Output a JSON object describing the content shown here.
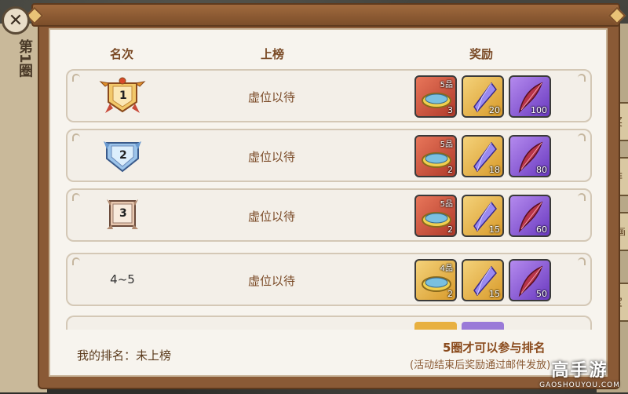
{
  "background": {
    "left_title": "第1圈",
    "right_tabs": [
      "奖",
      "排",
      "动画",
      "宝"
    ]
  },
  "header": {
    "rank_col": "名次",
    "list_col": "上榜",
    "reward_col": "奖励"
  },
  "rows": [
    {
      "rank": "1",
      "rank_type": "gold-badge",
      "status": "虚位以待",
      "rewards": [
        {
          "icon": "ring-icon",
          "color": "red",
          "grade": "5品",
          "count": "3"
        },
        {
          "icon": "crystal-icon",
          "color": "gold",
          "count": "20"
        },
        {
          "icon": "feather-icon",
          "color": "purple",
          "count": "100"
        }
      ]
    },
    {
      "rank": "2",
      "rank_type": "silver-badge",
      "status": "虚位以待",
      "rewards": [
        {
          "icon": "ring-icon",
          "color": "red",
          "grade": "5品",
          "count": "2"
        },
        {
          "icon": "crystal-icon",
          "color": "gold",
          "count": "18"
        },
        {
          "icon": "feather-icon",
          "color": "purple",
          "count": "80"
        }
      ]
    },
    {
      "rank": "3",
      "rank_type": "bronze-badge",
      "status": "虚位以待",
      "rewards": [
        {
          "icon": "ring-icon",
          "color": "red",
          "grade": "5品",
          "count": "2"
        },
        {
          "icon": "crystal-icon",
          "color": "gold",
          "count": "15"
        },
        {
          "icon": "feather-icon",
          "color": "purple",
          "count": "60"
        }
      ]
    },
    {
      "rank": "4~5",
      "rank_type": "text",
      "status": "虚位以待",
      "rewards": [
        {
          "icon": "ring-icon",
          "color": "gold",
          "grade": "4品",
          "count": "2"
        },
        {
          "icon": "crystal-icon",
          "color": "gold",
          "count": "15"
        },
        {
          "icon": "feather-icon",
          "color": "purple",
          "count": "50"
        }
      ]
    }
  ],
  "footer": {
    "my_rank": "我的排名：未上榜",
    "requirement": "5圈才可以参与排名",
    "requirement_note": "(活动结束后奖励通过邮件发放)"
  },
  "watermark": {
    "main": "高手游",
    "sub": "GAOSHOUYOU.COM"
  },
  "colors": {
    "frame": "#8a5a36",
    "panel": "#f7f4ee",
    "text_brown": "#7a4a26"
  }
}
